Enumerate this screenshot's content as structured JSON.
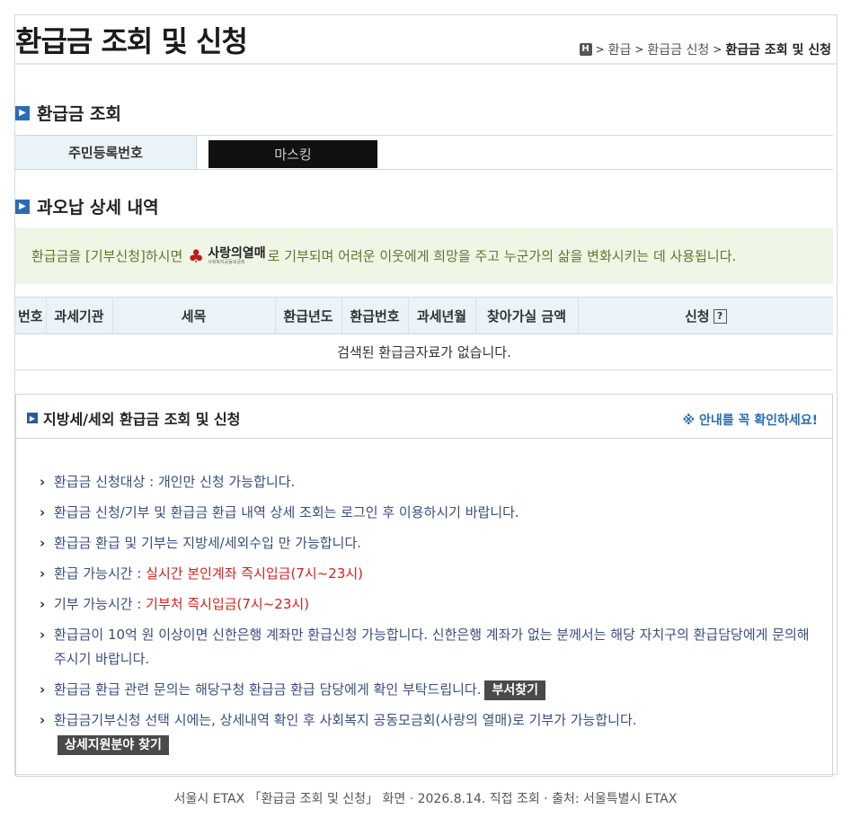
{
  "page": {
    "title": "환급금 조회 및 신청",
    "breadcrumb": {
      "home": "H",
      "items": [
        "환급",
        "환급금 신청",
        "환급금 조회 및 신청"
      ]
    }
  },
  "lookup": {
    "section_title": "환급금 조회",
    "id_label": "주민등록번호",
    "id_value": "마스킹"
  },
  "overpayment": {
    "section_title": "과오납 상세 내역",
    "notice_before": "환급금을 [기부신청]하시면",
    "logo_text": "사랑의열매",
    "logo_sub": "사회복지공동모금회",
    "notice_after": "로 기부되며 어려운 이웃에게 희망을 주고 누군가의 삶을 변화시키는 데 사용됩니다.",
    "table": {
      "headers": [
        "번호",
        "과세기관",
        "세목",
        "환급년도",
        "환급번호",
        "과세년월",
        "찾아가실 금액",
        "신청"
      ],
      "help_mark": "?",
      "empty_message": "검색된 환급금자료가 없습니다."
    }
  },
  "local": {
    "title": "지방세/세외 환급금 조회 및 신청",
    "notice_link": "※ 안내를 꼭 확인하세요!",
    "items": [
      {
        "text": "환급금 신청대상 : 개인만 신청 가능합니다."
      },
      {
        "text": "환급금 신청/기부 및 환급금 환급 내역 상세 조회는 로그인 후 이용하시기 바랍니다."
      },
      {
        "text": "환급금 환급 및 기부는 지방세/세외수입 만 가능합니다."
      },
      {
        "label": "환급 가능시간 : ",
        "highlight": "실시간 본인계좌 즉시입금(7시~23시)"
      },
      {
        "label": "기부 가능시간 : ",
        "highlight": "기부처 즉시입금(7시~23시)"
      },
      {
        "text": "환급금이 10억 원 이상이면 신한은행 계좌만 환급신청 가능합니다. 신한은행 계좌가 없는 분께서는 해당 자치구의 환급담당에게 문의해 주시기 바랍니다."
      },
      {
        "text": "환급금 환급 관련 문의는 해당구청 환급금 환급 담당에게 확인 부탁드립니다.",
        "button": "부서찾기"
      },
      {
        "text": "환급금기부신청 선택 시에는, 상세내역 확인 후 사회복지 공동모금회(사랑의 열매)로 기부가 가능합니다.",
        "button": "상세지원분야 찾기"
      }
    ]
  },
  "caption": "서울시 ETAX 「환급금 조회 및 신청」 화면 · 2026.8.14. 직접 조회 · 출처: 서울특별시 ETAX",
  "colors": {
    "accent_blue": "#2a6db5",
    "header_bg": "#eaf3f8",
    "notice_bg": "#eff6e6",
    "highlight_red": "#d42020"
  }
}
